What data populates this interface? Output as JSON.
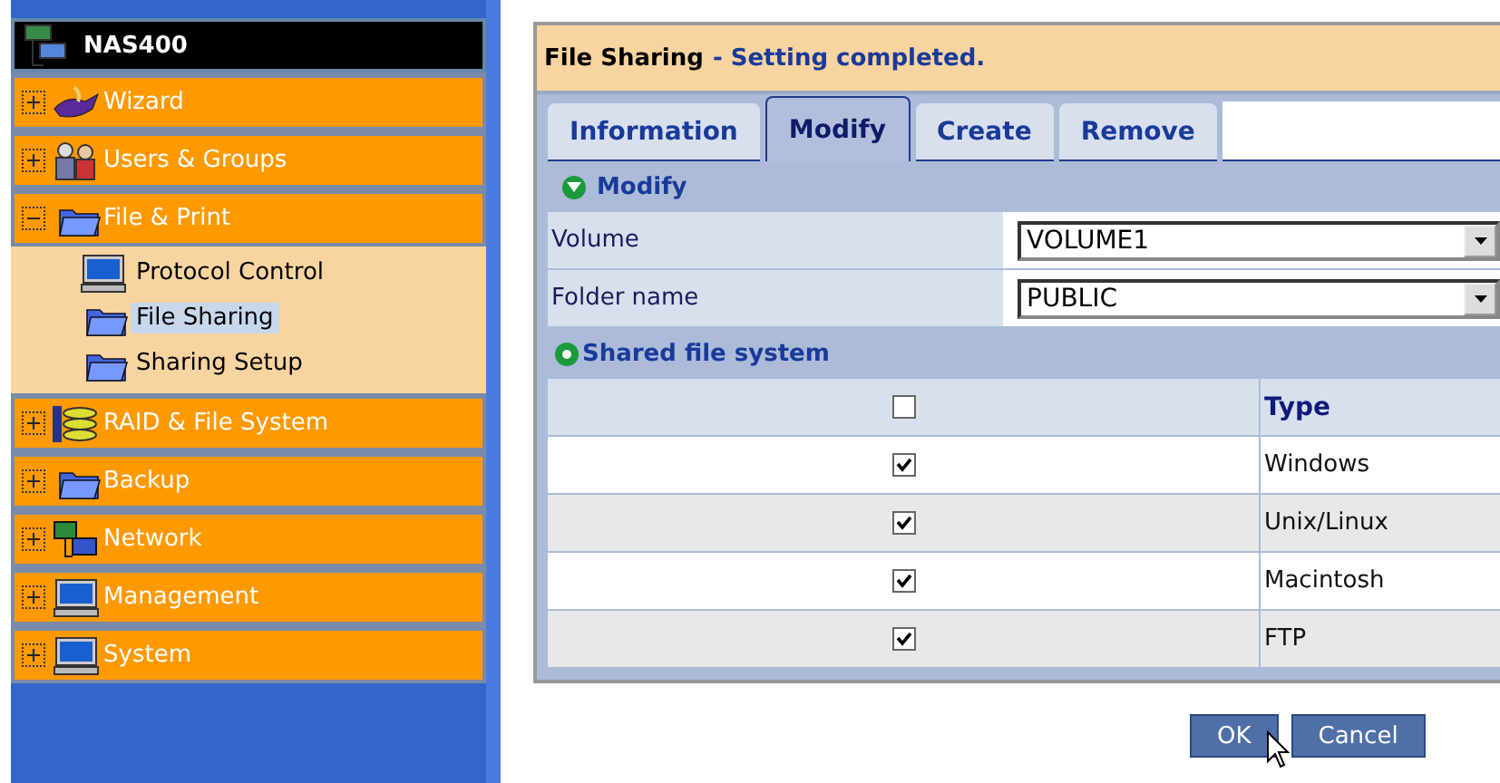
{
  "sidebar": {
    "title": "NAS400",
    "items": [
      {
        "label": "Wizard",
        "expanded": false
      },
      {
        "label": "Users & Groups",
        "expanded": false
      },
      {
        "label": "File & Print",
        "expanded": true,
        "children": [
          {
            "label": "Protocol Control",
            "selected": false
          },
          {
            "label": "File Sharing",
            "selected": true
          },
          {
            "label": "Sharing Setup",
            "selected": false
          }
        ]
      },
      {
        "label": "RAID & File System",
        "expanded": false
      },
      {
        "label": "Backup",
        "expanded": false
      },
      {
        "label": "Network",
        "expanded": false
      },
      {
        "label": "Management",
        "expanded": false
      },
      {
        "label": "System",
        "expanded": false
      }
    ]
  },
  "panel": {
    "title": "File Sharing",
    "status": "- Setting completed.",
    "tabs": [
      {
        "label": "Information",
        "selected": false
      },
      {
        "label": "Modify",
        "selected": true
      },
      {
        "label": "Create",
        "selected": false
      },
      {
        "label": "Remove",
        "selected": false
      }
    ],
    "section": {
      "label": "Modify",
      "expanded": true
    },
    "fields": [
      {
        "label": "Volume",
        "value": "VOLUME1"
      },
      {
        "label": "Folder name",
        "value": "PUBLIC"
      }
    ],
    "shared_section": {
      "label": "Shared file system",
      "expanded": false
    },
    "table": {
      "header_checked": false,
      "column": "Type",
      "rows": [
        {
          "checked": true,
          "type": "Windows"
        },
        {
          "checked": true,
          "type": "Unix/Linux"
        },
        {
          "checked": true,
          "type": "Macintosh"
        },
        {
          "checked": true,
          "type": "FTP"
        }
      ]
    }
  },
  "buttons": [
    "OK",
    "Cancel"
  ]
}
